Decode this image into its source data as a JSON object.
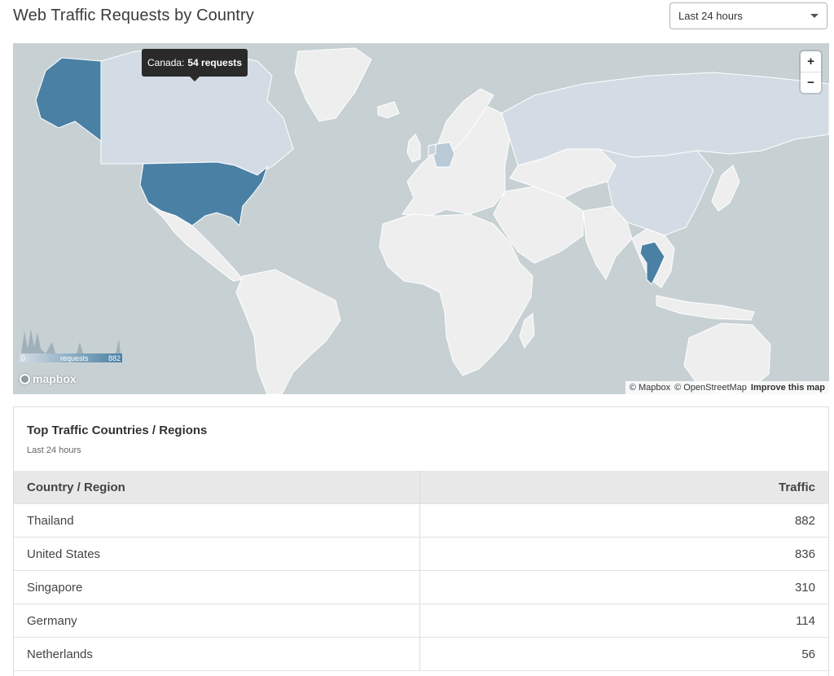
{
  "page": {
    "title": "Web Traffic Requests by Country"
  },
  "time_range": {
    "selected": "Last 24 hours"
  },
  "map": {
    "tooltip": {
      "country": "Canada:",
      "value": "54 requests"
    },
    "zoom_in": "+",
    "zoom_out": "−",
    "legend": {
      "min": "0",
      "label": "requests",
      "max": "882"
    },
    "logo": "mapbox",
    "attribution": {
      "mapbox": "© Mapbox",
      "osm": "© OpenStreetMap",
      "improve": "Improve this map"
    },
    "colors": {
      "water": "#c7d1d4",
      "land": "#eeeeee",
      "low": "#d3dce4",
      "high": "#4a80a4"
    }
  },
  "table": {
    "title": "Top Traffic Countries / Regions",
    "subtitle": "Last 24 hours",
    "columns": {
      "country": "Country / Region",
      "traffic": "Traffic"
    },
    "rows": [
      {
        "country": "Thailand",
        "traffic": "882"
      },
      {
        "country": "United States",
        "traffic": "836"
      },
      {
        "country": "Singapore",
        "traffic": "310"
      },
      {
        "country": "Germany",
        "traffic": "114"
      },
      {
        "country": "Netherlands",
        "traffic": "56"
      }
    ]
  }
}
